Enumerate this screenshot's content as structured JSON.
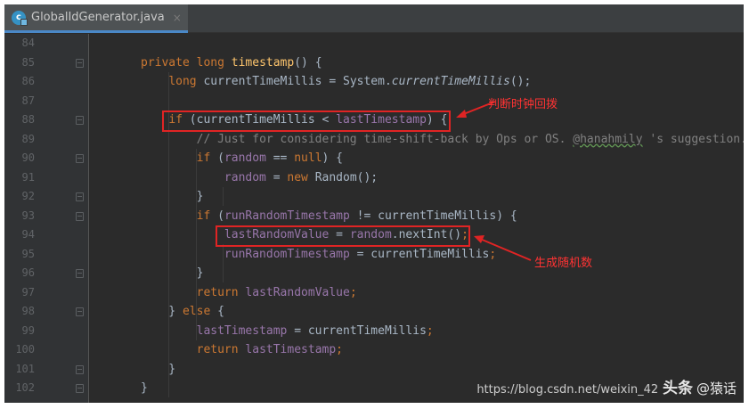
{
  "tab": {
    "file_name": "GlobalIdGenerator.java",
    "close_glyph": "×",
    "icon_letter": "c"
  },
  "colors": {
    "keyword": "#cc7832",
    "method": "#ffc66d",
    "field": "#9876aa",
    "comment": "#808080",
    "text": "#a9b7c6",
    "annotation": "#ff3333"
  },
  "lines": [
    {
      "num": "84",
      "fold": false,
      "tokens": []
    },
    {
      "num": "85",
      "fold": true,
      "tokens": [
        [
          "private ",
          "kw"
        ],
        [
          "long ",
          "kw"
        ],
        [
          "timestamp",
          "fn"
        ],
        [
          "() {",
          ""
        ]
      ]
    },
    {
      "num": "86",
      "fold": false,
      "tokens": [
        [
          "    ",
          ""
        ],
        [
          "long ",
          "kw"
        ],
        [
          "currentTimeMillis = System.",
          ""
        ],
        [
          "currentTimeMillis",
          "it"
        ],
        [
          "();",
          ""
        ]
      ]
    },
    {
      "num": "87",
      "fold": false,
      "tokens": []
    },
    {
      "num": "88",
      "fold": true,
      "tokens": [
        [
          "    ",
          ""
        ],
        [
          "if ",
          "kw"
        ],
        [
          "(currentTimeMillis < ",
          ""
        ],
        [
          "lastTimestamp",
          "fld"
        ],
        [
          ") {",
          ""
        ]
      ]
    },
    {
      "num": "89",
      "fold": false,
      "tokens": [
        [
          "        ",
          ""
        ],
        [
          "// Just for considering time-shift-back by Ops or OS. ",
          "cm"
        ],
        [
          "@hanahmily",
          "cm ul"
        ],
        [
          " 's suggestion.",
          "cm"
        ]
      ]
    },
    {
      "num": "90",
      "fold": true,
      "tokens": [
        [
          "        ",
          ""
        ],
        [
          "if ",
          "kw"
        ],
        [
          "(",
          ""
        ],
        [
          "random",
          "fld"
        ],
        [
          " == ",
          ""
        ],
        [
          "null",
          "kw"
        ],
        [
          ") {",
          ""
        ]
      ]
    },
    {
      "num": "91",
      "fold": false,
      "tokens": [
        [
          "            ",
          ""
        ],
        [
          "random",
          "fld"
        ],
        [
          " = ",
          ""
        ],
        [
          "new ",
          "kw"
        ],
        [
          "Random();",
          ""
        ]
      ]
    },
    {
      "num": "92",
      "fold": true,
      "tokens": [
        [
          "        }",
          ""
        ]
      ]
    },
    {
      "num": "93",
      "fold": true,
      "tokens": [
        [
          "        ",
          ""
        ],
        [
          "if ",
          "kw"
        ],
        [
          "(",
          ""
        ],
        [
          "runRandomTimestamp",
          "fld"
        ],
        [
          " != currentTimeMillis) {",
          ""
        ]
      ]
    },
    {
      "num": "94",
      "fold": false,
      "tokens": [
        [
          "            ",
          ""
        ],
        [
          "lastRandomValue",
          "fld"
        ],
        [
          " = ",
          ""
        ],
        [
          "random",
          "fld"
        ],
        [
          ".nextInt()",
          ""
        ],
        [
          ";",
          "kw"
        ]
      ]
    },
    {
      "num": "95",
      "fold": false,
      "tokens": [
        [
          "            ",
          ""
        ],
        [
          "runRandomTimestamp",
          "fld"
        ],
        [
          " = currentTimeMillis",
          ""
        ],
        [
          ";",
          "kw"
        ]
      ]
    },
    {
      "num": "96",
      "fold": true,
      "tokens": [
        [
          "        }",
          ""
        ]
      ]
    },
    {
      "num": "97",
      "fold": false,
      "tokens": [
        [
          "        ",
          ""
        ],
        [
          "return ",
          "kw"
        ],
        [
          "lastRandomValue",
          "fld"
        ],
        [
          ";",
          "kw"
        ]
      ]
    },
    {
      "num": "98",
      "fold": true,
      "tokens": [
        [
          "    } ",
          ""
        ],
        [
          "else ",
          "kw"
        ],
        [
          "{",
          ""
        ]
      ]
    },
    {
      "num": "99",
      "fold": false,
      "tokens": [
        [
          "        ",
          ""
        ],
        [
          "lastTimestamp",
          "fld"
        ],
        [
          " = currentTimeMillis",
          ""
        ],
        [
          ";",
          "kw"
        ]
      ]
    },
    {
      "num": "100",
      "fold": false,
      "tokens": [
        [
          "        ",
          ""
        ],
        [
          "return ",
          "kw"
        ],
        [
          "lastTimestamp",
          "fld"
        ],
        [
          ";",
          "kw"
        ]
      ]
    },
    {
      "num": "101",
      "fold": true,
      "tokens": [
        [
          "    }",
          ""
        ]
      ]
    },
    {
      "num": "102",
      "fold": true,
      "tokens": [
        [
          "}",
          ""
        ]
      ]
    }
  ],
  "annotations": {
    "clock_rollback": "判断时钟回拨",
    "generate_random": "生成随机数"
  },
  "watermark": {
    "brand": "头条",
    "handle": "@猿话",
    "url": "https://blog.csdn.net/weixin_42"
  }
}
